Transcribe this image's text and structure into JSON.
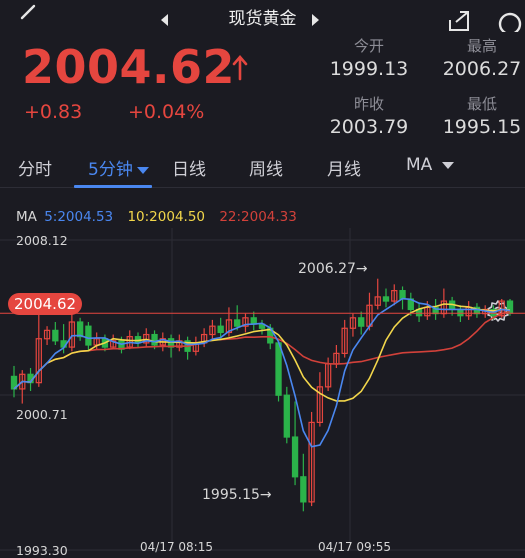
{
  "header": {
    "title": "现货黄金"
  },
  "quote": {
    "price": "2004.62",
    "change": "+0.83",
    "change_pct": "+0.04%",
    "stats": [
      {
        "label": "今开",
        "value": "1999.13"
      },
      {
        "label": "最高",
        "value": "2006.27"
      },
      {
        "label": "昨收",
        "value": "2003.79"
      },
      {
        "label": "最低",
        "value": "1995.15"
      }
    ]
  },
  "tabs": [
    "分时",
    "5分钟",
    "日线",
    "周线",
    "月线",
    "MA"
  ],
  "active_tab": "5分钟",
  "legend": {
    "ma": "MA",
    "ma5": "5:2004.53",
    "ma10": "10:2004.50",
    "ma22": "22:2004.33"
  },
  "chart_labels": {
    "y_top": "2008.12",
    "y_mid": "2000.71",
    "y_bottom": "1993.30",
    "current_price": "2004.62",
    "high_anno": "2006.27→",
    "low_anno": "1995.15→",
    "time_1": "04/17 08:15",
    "time_2": "04/17 09:55"
  },
  "colors": {
    "background": "#1b1b22",
    "up": "#e5463f",
    "down": "#2bb34a",
    "ma5": "#4a87f0",
    "ma10": "#f2d64b",
    "ma22": "#d2413a",
    "accent": "#4a87f0"
  },
  "chart_data": {
    "type": "candlestick",
    "ylim": [
      1993.3,
      2008.12
    ],
    "candles": [
      [
        2001.6,
        2001.0,
        2002.1,
        2000.6
      ],
      [
        2001.0,
        2001.7,
        2001.9,
        2000.3
      ],
      [
        2001.7,
        2001.3,
        2002.0,
        2000.9
      ],
      [
        2001.3,
        2003.4,
        2004.9,
        2001.1
      ],
      [
        2003.4,
        2003.8,
        2004.0,
        2003.1
      ],
      [
        2003.8,
        2003.3,
        2004.2,
        2003.1
      ],
      [
        2003.3,
        2003.0,
        2004.1,
        2002.7
      ],
      [
        2003.0,
        2004.2,
        2004.8,
        2002.8
      ],
      [
        2004.2,
        2003.5,
        2004.4,
        2003.3
      ],
      [
        2004.0,
        2003.1,
        2004.2,
        2002.8
      ],
      [
        2003.1,
        2003.4,
        2003.7,
        2002.9
      ],
      [
        2003.4,
        2003.0,
        2003.6,
        2002.8
      ],
      [
        2003.0,
        2003.3,
        2003.6,
        2002.9
      ],
      [
        2003.3,
        2002.9,
        2003.5,
        2002.7
      ],
      [
        2003.0,
        2003.5,
        2003.8,
        2002.9
      ],
      [
        2003.5,
        2003.2,
        2003.7,
        2003.0
      ],
      [
        2003.2,
        2003.6,
        2003.9,
        2003.0
      ],
      [
        2003.6,
        2003.1,
        2003.8,
        2002.9
      ],
      [
        2003.1,
        2003.4,
        2003.7,
        2002.8
      ],
      [
        2003.4,
        2003.0,
        2003.6,
        2002.5
      ],
      [
        2003.0,
        2003.3,
        2003.6,
        2002.8
      ],
      [
        2003.3,
        2002.8,
        2003.5,
        2002.4
      ],
      [
        2002.8,
        2003.2,
        2003.5,
        2002.6
      ],
      [
        2003.2,
        2003.6,
        2003.9,
        2003.0
      ],
      [
        2003.6,
        2004.0,
        2004.3,
        2003.4
      ],
      [
        2004.0,
        2003.7,
        2004.4,
        2003.4
      ],
      [
        2003.7,
        2004.3,
        2004.9,
        2003.5
      ],
      [
        2004.3,
        2004.0,
        2005.0,
        2003.8
      ],
      [
        2004.0,
        2004.4,
        2004.6,
        2003.7
      ],
      [
        2004.4,
        2004.1,
        2004.7,
        2003.8
      ],
      [
        2004.1,
        2003.9,
        2004.3,
        2003.6
      ],
      [
        2003.9,
        2003.2,
        2004.1,
        2002.9
      ],
      [
        2003.2,
        2000.7,
        2003.4,
        2000.4
      ],
      [
        2000.7,
        1998.7,
        2001.1,
        1998.4
      ],
      [
        1998.7,
        1996.8,
        2000.4,
        1996.4
      ],
      [
        1996.8,
        1995.6,
        1997.9,
        1995.15
      ],
      [
        1995.6,
        1999.4,
        1999.9,
        1995.4
      ],
      [
        1999.4,
        2001.1,
        2001.8,
        1999.2
      ],
      [
        2001.1,
        2002.2,
        2002.5,
        2000.9
      ],
      [
        2002.2,
        2002.7,
        2003.1,
        2002.0
      ],
      [
        2002.7,
        2003.9,
        2004.3,
        2002.5
      ],
      [
        2003.9,
        2004.4,
        2004.6,
        2003.5
      ],
      [
        2004.4,
        2004.0,
        2004.7,
        2003.6
      ],
      [
        2004.0,
        2005.0,
        2005.6,
        2003.8
      ],
      [
        2005.0,
        2005.4,
        2006.27,
        2004.8
      ],
      [
        2005.4,
        2005.2,
        2005.8,
        2004.9
      ],
      [
        2005.2,
        2005.7,
        2006.0,
        2005.0
      ],
      [
        2005.7,
        2005.3,
        2005.9,
        2004.8
      ],
      [
        2005.3,
        2004.8,
        2005.6,
        2004.5
      ],
      [
        2004.8,
        2004.5,
        2005.1,
        2004.2
      ],
      [
        2004.5,
        2004.9,
        2005.2,
        2004.3
      ],
      [
        2004.9,
        2004.6,
        2005.3,
        2004.3
      ],
      [
        2004.6,
        2005.2,
        2005.8,
        2004.4
      ],
      [
        2005.2,
        2004.8,
        2005.4,
        2004.5
      ],
      [
        2004.8,
        2004.5,
        2005.0,
        2004.2
      ],
      [
        2004.5,
        2004.9,
        2005.2,
        2004.3
      ],
      [
        2004.9,
        2004.6,
        2005.1,
        2004.4
      ],
      [
        2004.6,
        2004.8,
        2005.0,
        2004.4
      ],
      [
        2004.8,
        2004.5,
        2005.0,
        2004.3
      ],
      [
        2004.5,
        2005.2,
        2005.3,
        2004.4
      ],
      [
        2005.2,
        2004.62,
        2005.3,
        2004.5
      ]
    ],
    "ma5_last": 2004.53,
    "ma10_last": 2004.5,
    "ma22_last": 2004.33
  }
}
